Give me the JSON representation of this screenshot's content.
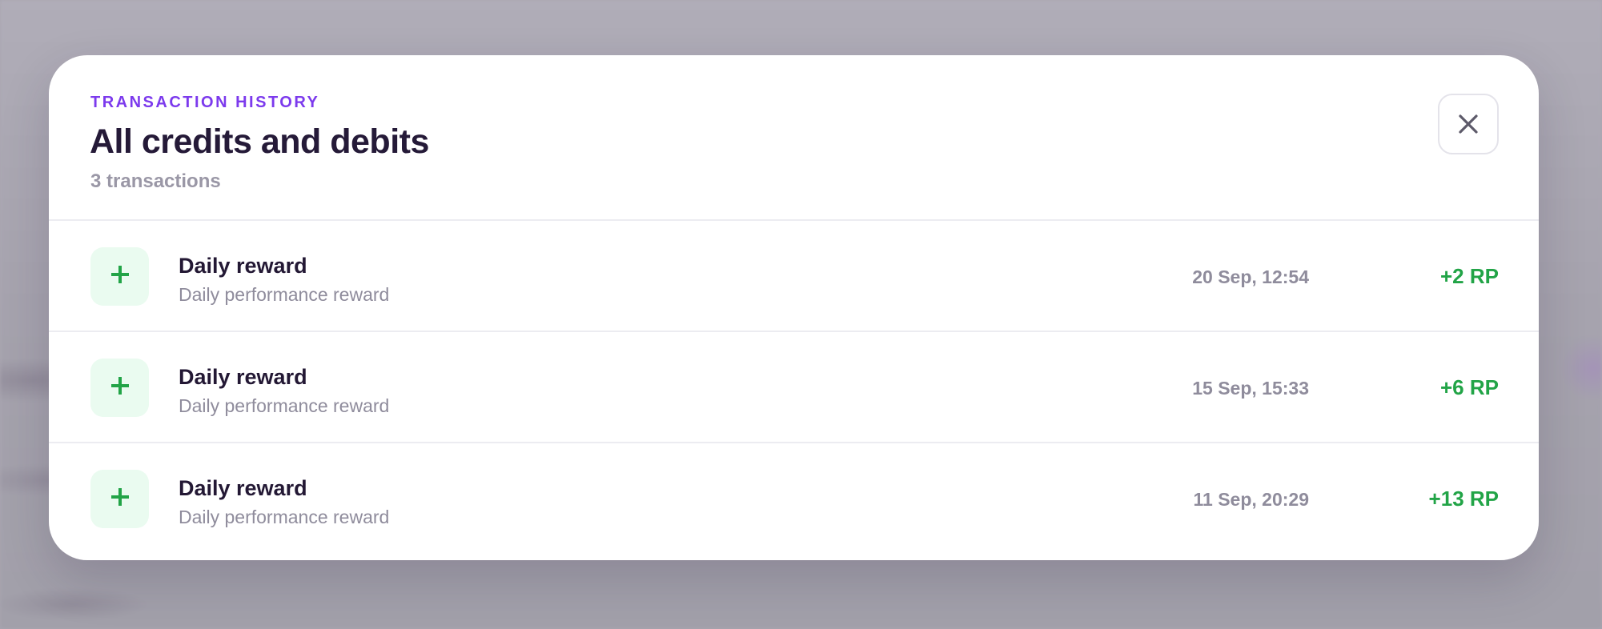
{
  "modal": {
    "eyebrow": "TRANSACTION HISTORY",
    "title": "All credits and debits",
    "subtitle": "3 transactions",
    "close_icon": "close-icon"
  },
  "colors": {
    "accent": "#7c3aed",
    "credit": "#22a447",
    "credit_bg": "#eafbf0",
    "title": "#251a38",
    "muted": "#8f8c9c"
  },
  "transactions": [
    {
      "icon": "plus-icon",
      "title": "Daily reward",
      "description": "Daily performance reward",
      "date": "20 Sep, 12:54",
      "amount": "+2 RP"
    },
    {
      "icon": "plus-icon",
      "title": "Daily reward",
      "description": "Daily performance reward",
      "date": "15 Sep, 15:33",
      "amount": "+6 RP"
    },
    {
      "icon": "plus-icon",
      "title": "Daily reward",
      "description": "Daily performance reward",
      "date": "11 Sep, 20:29",
      "amount": "+13 RP"
    }
  ]
}
